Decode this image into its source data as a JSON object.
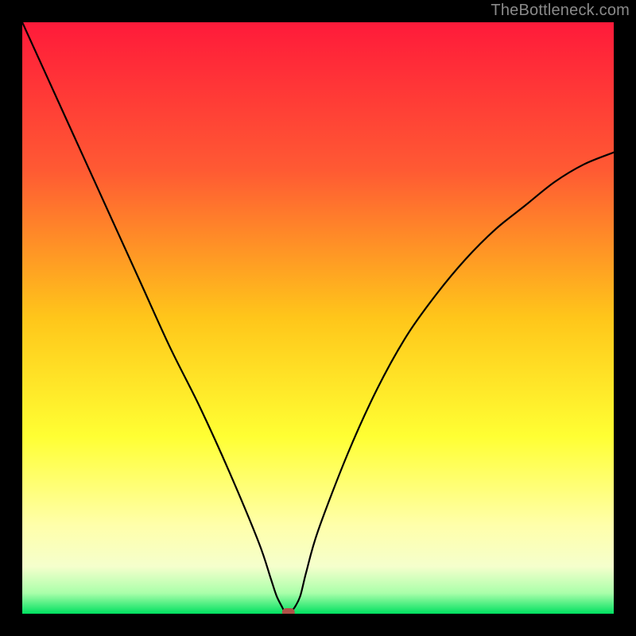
{
  "watermark": "TheBottleneck.com",
  "chart_data": {
    "type": "line",
    "title": "",
    "xlabel": "",
    "ylabel": "",
    "xlim": [
      0,
      100
    ],
    "ylim": [
      0,
      100
    ],
    "background_gradient": {
      "stops": [
        {
          "offset": 0.0,
          "color": "#ff1a3a"
        },
        {
          "offset": 0.25,
          "color": "#ff5a33"
        },
        {
          "offset": 0.5,
          "color": "#ffc61a"
        },
        {
          "offset": 0.7,
          "color": "#ffff33"
        },
        {
          "offset": 0.85,
          "color": "#ffffaa"
        },
        {
          "offset": 0.92,
          "color": "#f5ffcc"
        },
        {
          "offset": 0.965,
          "color": "#aaffaa"
        },
        {
          "offset": 1.0,
          "color": "#00e060"
        }
      ]
    },
    "series": [
      {
        "name": "bottleneck-curve",
        "x": [
          0,
          5,
          10,
          15,
          20,
          25,
          30,
          35,
          40,
          42,
          43,
          44,
          44.5,
          45,
          46,
          47,
          48,
          50,
          55,
          60,
          65,
          70,
          75,
          80,
          85,
          90,
          95,
          100
        ],
        "y": [
          100,
          89,
          78,
          67,
          56,
          45,
          35,
          24,
          12,
          6,
          3,
          1,
          0,
          0,
          1,
          3,
          7,
          14,
          27,
          38,
          47,
          54,
          60,
          65,
          69,
          73,
          76,
          78
        ]
      }
    ],
    "marker": {
      "name": "optimal-point",
      "x": 45,
      "y": 0,
      "color": "#b05048"
    }
  }
}
